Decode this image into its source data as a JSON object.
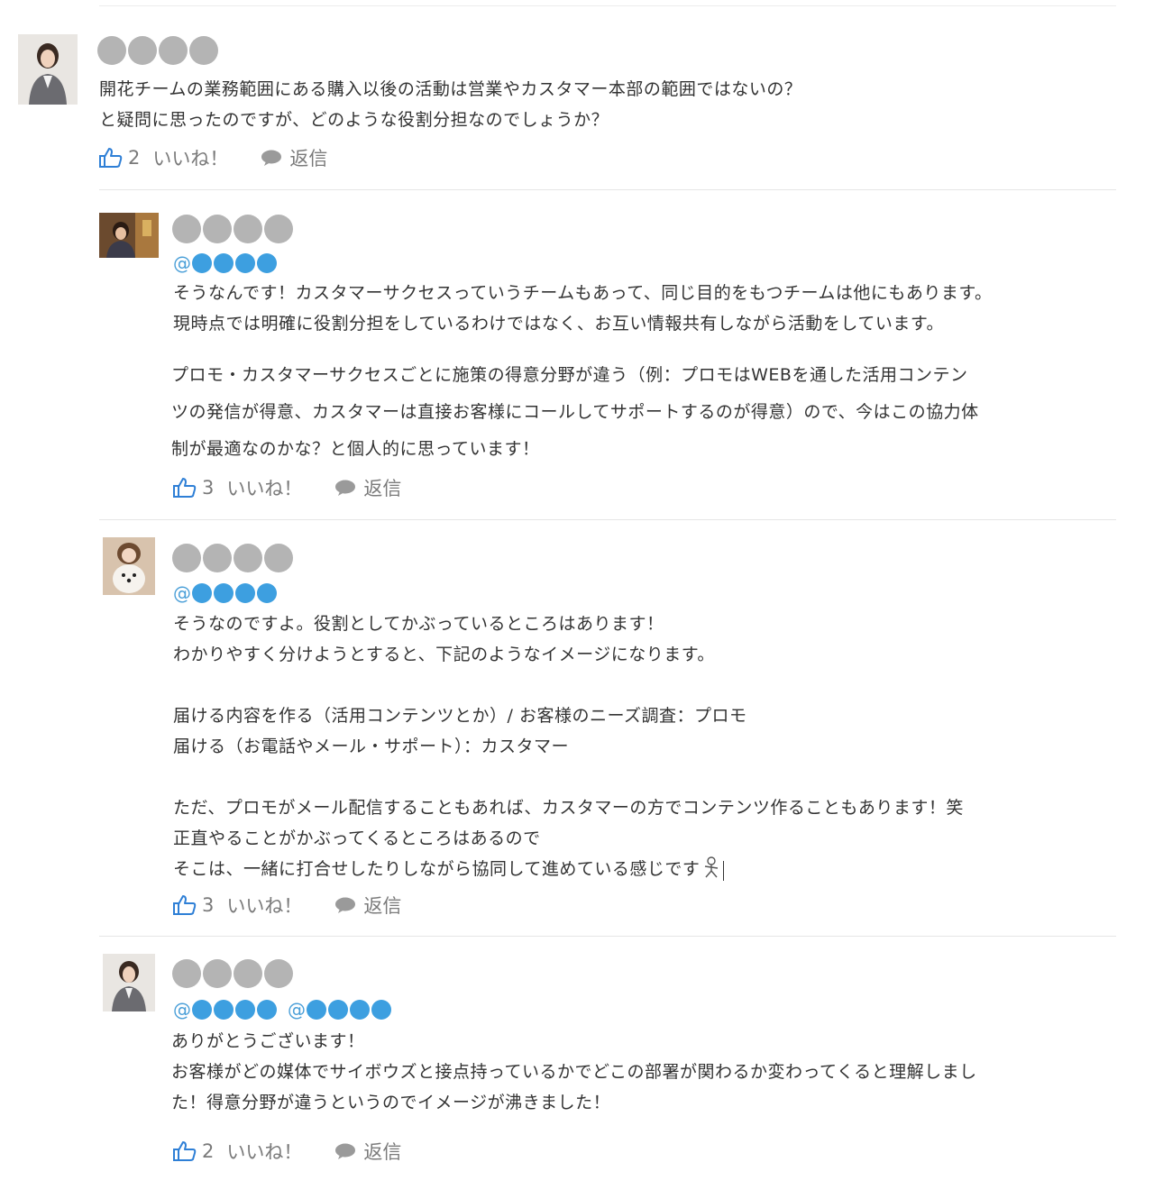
{
  "comments": [
    {
      "body": "開花チームの業務範囲にある購入以後の活動は営業やカスタマー本部の範囲ではないの？\nと疑問に思ったのですが、どのような役割分担なのでしょうか？",
      "like_count": "2",
      "like_label": "いいね！",
      "reply_label": "返信"
    },
    {
      "body_p1": "そうなんです！カスタマーサクセスっていうチームもあって、同じ目的をもつチームは他にもあります。\n現時点では明確に役割分担をしているわけではなく、お互い情報共有しながら活動をしています。",
      "body_p2": "プロモ・カスタマーサクセスごとに施策の得意分野が違う（例：プロモはWEBを通した活用コンテン\nツの発信が得意、カスタマーは直接お客様にコールしてサポートするのが得意）ので、今はこの協力体\n制が最適なのかな？と個人的に思っています！",
      "mention_at": "@",
      "like_count": "3",
      "like_label": "いいね！",
      "reply_label": "返信"
    },
    {
      "body": "そうなのですよ。役割としてかぶっているところはあります！\nわかりやすく分けようとすると、下記のようなイメージになります。\n\n届ける内容を作る（活用コンテンツとか）/ お客様のニーズ調査：プロモ\n届ける（お電話やメール・サポート）：カスタマー\n\nただ、プロモがメール配信することもあれば、カスタマーの方でコンテンツ作ることもあります！笑\n正直やることがかぶってくるところはあるので\nそこは、一緒に打合せしたりしながら協同して進めている感じです",
      "mention_at": "@",
      "like_count": "3",
      "like_label": "いいね！",
      "reply_label": "返信"
    },
    {
      "body": "ありがとうございます！\nお客様がどの媒体でサイボウズと接点持っているかでどこの部署が関わるか変わってくると理解しまし\nた！得意分野が違うというのでイメージが沸きました！",
      "mention_at_1": "@",
      "mention_at_2": "@",
      "like_count": "2",
      "like_label": "いいね！",
      "reply_label": "返信"
    }
  ],
  "colors": {
    "like_icon": "#2e7fd6",
    "mention": "#3d9fe0",
    "name_placeholder": "#b4b4b4",
    "action_text": "#7a7a7a"
  },
  "icons": {
    "like": "thumbs-up-icon",
    "reply": "speech-bubble-icon",
    "emoji": "stick-figure-icon"
  }
}
